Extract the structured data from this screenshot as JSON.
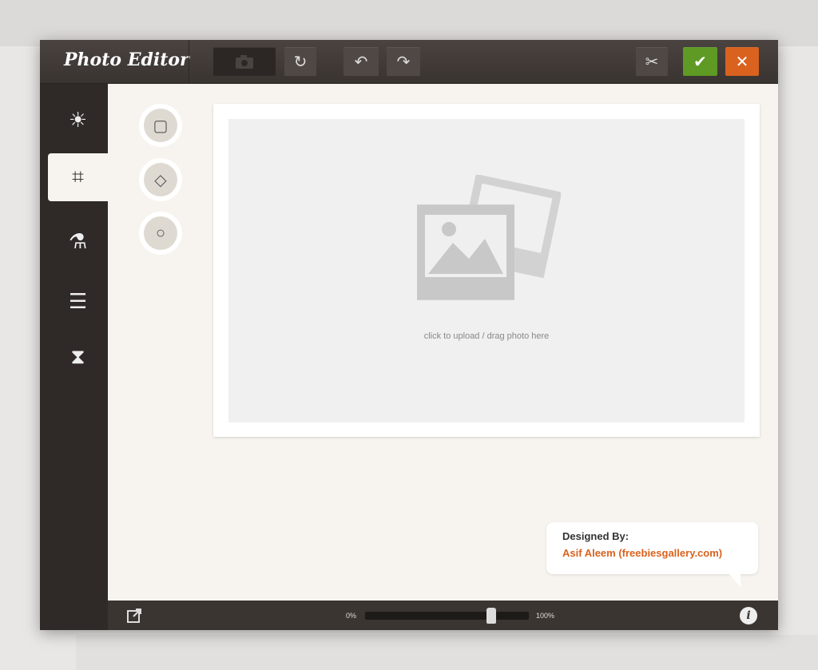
{
  "header": {
    "title": "Photo Editor"
  },
  "toolbar": {
    "camera": "camera-icon",
    "rotate": "↻",
    "undo": "↶",
    "redo": "↷",
    "settings": "✂",
    "confirm": "✔",
    "cancel": "✕",
    "confirm_color": "#5e9a24",
    "cancel_color": "#d9621e"
  },
  "sidebar": {
    "items": [
      {
        "icon": "☀",
        "name": "brightness"
      },
      {
        "icon": "⌗",
        "name": "crop",
        "active": true
      },
      {
        "icon": "⚗",
        "name": "effects"
      },
      {
        "icon": "☰",
        "name": "adjust"
      },
      {
        "icon": "⧗",
        "name": "history"
      }
    ]
  },
  "crop_tools": [
    {
      "icon": "▢",
      "name": "square"
    },
    {
      "icon": "◇",
      "name": "free"
    },
    {
      "icon": "○",
      "name": "circle"
    }
  ],
  "canvas": {
    "drop_text": "click to upload / drag photo here"
  },
  "credit": {
    "label": "Designed By:",
    "author": "Asif Aleem (freebiesgallery.com)"
  },
  "footer": {
    "min_label": "0%",
    "max_label": "100%",
    "slider_value": 0.77,
    "info": "i"
  }
}
